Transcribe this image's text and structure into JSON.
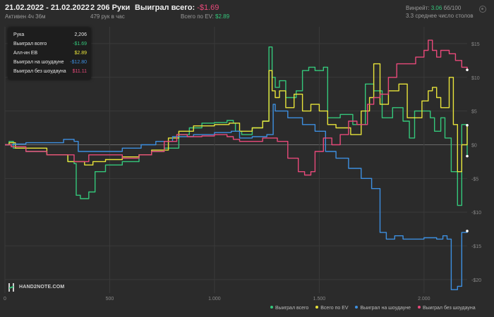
{
  "header": {
    "date_range": "21.02.2022 - 21.02.2022",
    "active_time": "Активен 4ч 36м",
    "hands": "2 206 Руки",
    "hands_per_hour": "479 рук в час",
    "won_label": "Выиграл всего:",
    "won_value": "-$1.69",
    "ev_label": "Всего по EV:",
    "ev_value": "$2.89",
    "winrate_label": "Винрейт:",
    "winrate_value": "3.06",
    "winrate_suffix": "бб/100",
    "tables": "3.3 среднее число столов"
  },
  "tooltip": {
    "rows": [
      {
        "label": "Рука",
        "value": "2,206",
        "color": "#e6e6e6"
      },
      {
        "label": "Выиграл всего",
        "value": "-$1.69",
        "color": "#34c77b"
      },
      {
        "label": "Алл-ин EВ",
        "value": "$2.89",
        "color": "#e8e33a"
      },
      {
        "label": "Выиграл на шоудауне",
        "value": "-$12.80",
        "color": "#3d8fe0"
      },
      {
        "label": "Выиграл без шоудауна",
        "value": "$11.11",
        "color": "#e8497a"
      }
    ]
  },
  "logo": {
    "text": "HAND2NOTE.COM"
  },
  "chart_data": {
    "type": "line",
    "x_ticks": [
      0,
      500,
      1000,
      1500,
      2000
    ],
    "x_tick_labels": [
      "0",
      "500",
      "1.000",
      "1.500",
      "2.000"
    ],
    "y_ticks": [
      15,
      10,
      5,
      0,
      -5,
      -10,
      -15,
      -20
    ],
    "y_tick_labels": [
      "$15",
      "$10",
      "$5",
      "$0",
      "-$5",
      "-$10",
      "-$15",
      "-$20"
    ],
    "xlim": [
      0,
      2206
    ],
    "ylim": [
      -22,
      17.5
    ],
    "grid": true,
    "legend_position": "bottom-right",
    "series": [
      {
        "name": "Выиграл всего",
        "color": "#34c77b",
        "points": [
          [
            0,
            0
          ],
          [
            20,
            0.5
          ],
          [
            40,
            -0.5
          ],
          [
            100,
            -1
          ],
          [
            200,
            -1.5
          ],
          [
            300,
            -2.5
          ],
          [
            330,
            -2.8
          ],
          [
            340,
            -7.5
          ],
          [
            360,
            -8
          ],
          [
            400,
            -7
          ],
          [
            430,
            -4
          ],
          [
            480,
            -3
          ],
          [
            560,
            -2.5
          ],
          [
            640,
            -1.5
          ],
          [
            700,
            -1
          ],
          [
            760,
            -0.5
          ],
          [
            830,
            1.5
          ],
          [
            880,
            2.5
          ],
          [
            940,
            3.2
          ],
          [
            1000,
            3.3
          ],
          [
            1060,
            3.6
          ],
          [
            1090,
            3.2
          ],
          [
            1100,
            2
          ],
          [
            1130,
            1.5
          ],
          [
            1180,
            2.5
          ],
          [
            1230,
            3.5
          ],
          [
            1260,
            14.5
          ],
          [
            1275,
            10
          ],
          [
            1290,
            8.5
          ],
          [
            1310,
            9.5
          ],
          [
            1340,
            7
          ],
          [
            1390,
            8
          ],
          [
            1420,
            11
          ],
          [
            1450,
            11.5
          ],
          [
            1480,
            11
          ],
          [
            1520,
            11.5
          ],
          [
            1540,
            4
          ],
          [
            1600,
            4.5
          ],
          [
            1660,
            3
          ],
          [
            1720,
            9
          ],
          [
            1760,
            8
          ],
          [
            1800,
            4
          ],
          [
            1850,
            5.5
          ],
          [
            1900,
            3.5
          ],
          [
            1930,
            1
          ],
          [
            1955,
            5
          ],
          [
            1990,
            5
          ],
          [
            2030,
            4
          ],
          [
            2050,
            2
          ],
          [
            2080,
            4
          ],
          [
            2100,
            1
          ],
          [
            2130,
            -4
          ],
          [
            2160,
            -9
          ],
          [
            2180,
            3
          ],
          [
            2206,
            -1.69
          ]
        ]
      },
      {
        "name": "Всего по EV",
        "color": "#e8e33a",
        "points": [
          [
            0,
            0
          ],
          [
            20,
            0.3
          ],
          [
            50,
            -0.5
          ],
          [
            200,
            -1.5
          ],
          [
            300,
            -2.5
          ],
          [
            340,
            -2.5
          ],
          [
            380,
            -3
          ],
          [
            420,
            -2.5
          ],
          [
            480,
            -2.2
          ],
          [
            560,
            -1.8
          ],
          [
            640,
            -1.5
          ],
          [
            700,
            -0.8
          ],
          [
            780,
            1
          ],
          [
            830,
            2
          ],
          [
            900,
            2.8
          ],
          [
            1000,
            3
          ],
          [
            1070,
            3.2
          ],
          [
            1120,
            2
          ],
          [
            1180,
            2.5
          ],
          [
            1230,
            3.5
          ],
          [
            1260,
            11
          ],
          [
            1275,
            8
          ],
          [
            1290,
            7
          ],
          [
            1310,
            8
          ],
          [
            1340,
            5.5
          ],
          [
            1380,
            7.5
          ],
          [
            1420,
            5
          ],
          [
            1460,
            6
          ],
          [
            1500,
            5
          ],
          [
            1540,
            3
          ],
          [
            1580,
            2.5
          ],
          [
            1600,
            2.5
          ],
          [
            1650,
            1.5
          ],
          [
            1700,
            5
          ],
          [
            1740,
            7
          ],
          [
            1760,
            12
          ],
          [
            1790,
            6
          ],
          [
            1830,
            8
          ],
          [
            1880,
            9
          ],
          [
            1920,
            4
          ],
          [
            1950,
            4
          ],
          [
            1990,
            6.5
          ],
          [
            2020,
            8
          ],
          [
            2040,
            8.5
          ],
          [
            2060,
            7
          ],
          [
            2080,
            5.5
          ],
          [
            2120,
            10
          ],
          [
            2140,
            3
          ],
          [
            2160,
            -4
          ],
          [
            2180,
            0
          ],
          [
            2206,
            2.89
          ]
        ]
      },
      {
        "name": "Выиграл на шоудауне",
        "color": "#3d8fe0",
        "points": [
          [
            0,
            0
          ],
          [
            40,
            0.1
          ],
          [
            100,
            0.3
          ],
          [
            200,
            0.3
          ],
          [
            280,
            0.8
          ],
          [
            330,
            0.5
          ],
          [
            350,
            -1
          ],
          [
            450,
            -1
          ],
          [
            560,
            -0.5
          ],
          [
            650,
            0
          ],
          [
            720,
            0.5
          ],
          [
            800,
            1.2
          ],
          [
            900,
            1.5
          ],
          [
            1000,
            1.8
          ],
          [
            1080,
            2
          ],
          [
            1120,
            1
          ],
          [
            1180,
            1.2
          ],
          [
            1250,
            1.5
          ],
          [
            1280,
            6
          ],
          [
            1290,
            5
          ],
          [
            1350,
            4
          ],
          [
            1420,
            3
          ],
          [
            1480,
            2
          ],
          [
            1530,
            -1
          ],
          [
            1580,
            -2
          ],
          [
            1640,
            -3.5
          ],
          [
            1700,
            -5
          ],
          [
            1750,
            -6.5
          ],
          [
            1770,
            -6.5
          ],
          [
            1790,
            -13
          ],
          [
            1820,
            -14
          ],
          [
            1860,
            -13.5
          ],
          [
            1900,
            -14
          ],
          [
            1950,
            -14
          ],
          [
            2000,
            -13.8
          ],
          [
            2060,
            -14
          ],
          [
            2090,
            -13.5
          ],
          [
            2110,
            -14
          ],
          [
            2130,
            -21.5
          ],
          [
            2160,
            -21
          ],
          [
            2180,
            -13
          ],
          [
            2206,
            -12.8
          ]
        ]
      },
      {
        "name": "Выиграл без шоудауна",
        "color": "#e8497a",
        "points": [
          [
            0,
            0
          ],
          [
            30,
            -0.3
          ],
          [
            100,
            -1
          ],
          [
            200,
            -1.5
          ],
          [
            330,
            -2.5
          ],
          [
            400,
            -1.5
          ],
          [
            480,
            -1.5
          ],
          [
            560,
            -2
          ],
          [
            640,
            -1.5
          ],
          [
            700,
            -1
          ],
          [
            760,
            0.5
          ],
          [
            820,
            1.5
          ],
          [
            870,
            1.2
          ],
          [
            940,
            1.3
          ],
          [
            1000,
            1.5
          ],
          [
            1060,
            1.2
          ],
          [
            1090,
            0.8
          ],
          [
            1120,
            0.5
          ],
          [
            1180,
            0.5
          ],
          [
            1230,
            1
          ],
          [
            1270,
            1
          ],
          [
            1300,
            0.5
          ],
          [
            1350,
            -2
          ],
          [
            1400,
            -4
          ],
          [
            1430,
            -4.5
          ],
          [
            1460,
            -4
          ],
          [
            1480,
            -1
          ],
          [
            1520,
            1
          ],
          [
            1560,
            0
          ],
          [
            1600,
            1.5
          ],
          [
            1640,
            3.5
          ],
          [
            1680,
            3
          ],
          [
            1730,
            6
          ],
          [
            1760,
            7
          ],
          [
            1790,
            7.5
          ],
          [
            1830,
            10
          ],
          [
            1870,
            12
          ],
          [
            1920,
            12
          ],
          [
            1960,
            13
          ],
          [
            2000,
            14
          ],
          [
            2020,
            15.5
          ],
          [
            2040,
            14
          ],
          [
            2060,
            13
          ],
          [
            2080,
            14
          ],
          [
            2120,
            13.5
          ],
          [
            2150,
            12.5
          ],
          [
            2180,
            11.5
          ],
          [
            2206,
            11.11
          ]
        ]
      }
    ]
  }
}
